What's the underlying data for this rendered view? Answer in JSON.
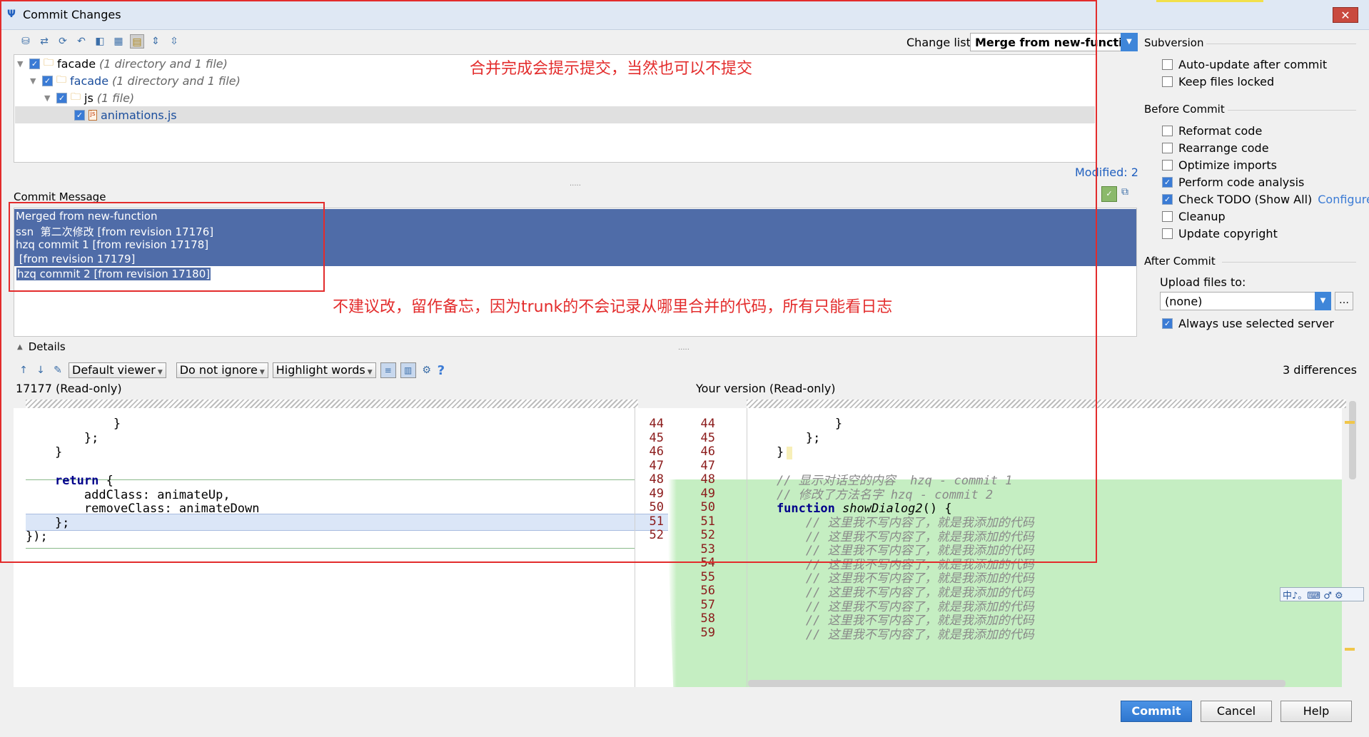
{
  "window": {
    "title": "Commit Changes",
    "close_glyph": "✕"
  },
  "toolbar": {
    "icons": [
      "database-icon",
      "move-icon",
      "refresh-icon",
      "rollback-icon",
      "diff-icon",
      "group-icon",
      "changelist-icon",
      "expand-icon",
      "collapse-icon"
    ]
  },
  "changelist": {
    "label": "Change list:",
    "value": "Merge from new-function"
  },
  "tree": {
    "rows": [
      {
        "name": "facade",
        "meta": "(1 directory and 1 file)"
      },
      {
        "name": "facade",
        "meta": "(1 directory and 1 file)"
      },
      {
        "name": "js",
        "meta": "(1 file)"
      },
      {
        "name": "animations.js",
        "meta": ""
      }
    ]
  },
  "annotations": {
    "top": "合并完成会提示提交，当然也可以不提交",
    "middle": "不建议改，留作备忘，因为trunk的不会记录从哪里合并的代码，所有只能看日志"
  },
  "modified": "Modified: 2",
  "commit_message": {
    "label": "Commit Message",
    "lines": [
      "Merged from new-function",
      "ssn  第二次修改 [from revision 17176]",
      "hzq commit 1 [from revision 17178]",
      " [from revision 17179]",
      "hzq commit 2 [from revision 17180]"
    ]
  },
  "details": {
    "label": "Details",
    "viewer": "Default viewer",
    "ignore": "Do not ignore",
    "highlight": "Highlight words",
    "help": "?",
    "differences": "3 differences",
    "left_title": "17177 (Read-only)",
    "right_title": "Your version (Read-only)"
  },
  "diff": {
    "left_lines": [
      "            }",
      "        };",
      "    }",
      "",
      "    return {",
      "        addClass: animateUp,",
      "        removeClass: animateDown",
      "    };",
      "});"
    ],
    "left_nums": [
      "44",
      "45",
      "46",
      "47",
      "48",
      "49",
      "50",
      "51",
      "52"
    ],
    "right_nums": [
      "44",
      "45",
      "46",
      "47",
      "48",
      "49",
      "50",
      "51",
      "52",
      "53",
      "54",
      "55",
      "56",
      "57",
      "58",
      "59"
    ],
    "right_plain": [
      "            }",
      "        };",
      "    }",
      ""
    ],
    "right_comment1": "    // 显示对话空的内容  hzq - commit 1",
    "right_comment2": "    // 修改了方法名字 hzq - commit 2",
    "right_fn_kw": "    function ",
    "right_fn_name": "showDialog2",
    "right_fn_rest": "() {",
    "right_body": "        // 这里我不写内容了，就是我添加的代码",
    "kw_return": "return"
  },
  "subversion": {
    "title": "Subversion",
    "options": [
      {
        "label": "Auto-update after commit",
        "checked": false
      },
      {
        "label": "Keep files locked",
        "checked": false
      }
    ]
  },
  "before_commit": {
    "title": "Before Commit",
    "options": [
      {
        "label": "Reformat code",
        "checked": false
      },
      {
        "label": "Rearrange code",
        "checked": false
      },
      {
        "label": "Optimize imports",
        "checked": false
      },
      {
        "label": "Perform code analysis",
        "checked": true
      },
      {
        "label": "Check TODO (Show All)",
        "checked": true
      },
      {
        "label": "Cleanup",
        "checked": false
      },
      {
        "label": "Update copyright",
        "checked": false
      }
    ],
    "configure": "Configure"
  },
  "after_commit": {
    "title": "After Commit",
    "upload_label": "Upload files to:",
    "upload_value": "(none)",
    "always_label": "Always use selected server",
    "always_checked": true
  },
  "buttons": {
    "commit": "Commit",
    "cancel": "Cancel",
    "help": "Help"
  },
  "ime": {
    "text": "中♪。⌨ ♂ ⚙"
  },
  "colors": {
    "annotation": "#e32c2c",
    "selection": "#4f6ca8",
    "added": "#c5eec2",
    "link": "#3b7bd5"
  }
}
